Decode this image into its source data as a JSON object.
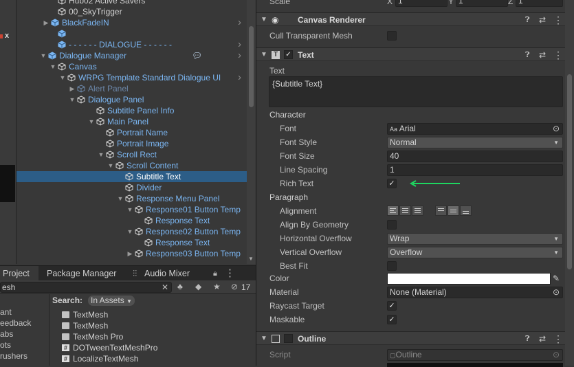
{
  "hierarchy": {
    "items": [
      {
        "label": "Hub02 Active Savers",
        "color": "white",
        "fold": ""
      },
      {
        "label": "00_SkyTrigger",
        "color": "white",
        "fold": ""
      },
      {
        "label": "BlackFadeIN",
        "color": "blue",
        "fold": "▶"
      },
      {
        "label": "",
        "color": "blue",
        "fold": ""
      },
      {
        "label": "- - - - - - DIALOGUE - - - - - -",
        "color": "blue",
        "fold": ""
      },
      {
        "label": "Dialogue Manager",
        "color": "blue",
        "fold": "▼"
      },
      {
        "label": "Canvas",
        "color": "blue",
        "fold": "▼"
      },
      {
        "label": "WRPG Template Standard Dialogue UI",
        "color": "blue",
        "fold": "▼"
      },
      {
        "label": "Alert Panel",
        "color": "dim",
        "fold": "▶"
      },
      {
        "label": "Dialogue Panel",
        "color": "blue",
        "fold": "▼"
      },
      {
        "label": "Subtitle Panel Info",
        "color": "blue",
        "fold": ""
      },
      {
        "label": "Main Panel",
        "color": "blue",
        "fold": "▼"
      },
      {
        "label": "Portrait Name",
        "color": "blue",
        "fold": ""
      },
      {
        "label": "Portrait Image",
        "color": "blue",
        "fold": ""
      },
      {
        "label": "Scroll Rect",
        "color": "blue",
        "fold": "▼"
      },
      {
        "label": "Scroll Content",
        "color": "blue",
        "fold": "▼"
      },
      {
        "label": "Subtitle Text",
        "color": "white",
        "fold": ""
      },
      {
        "label": "Divider",
        "color": "blue",
        "fold": ""
      },
      {
        "label": "Response Menu Panel",
        "color": "blue",
        "fold": "▼"
      },
      {
        "label": "Response01 Button Temp",
        "color": "blue",
        "fold": "▼"
      },
      {
        "label": "Response Text",
        "color": "blue",
        "fold": ""
      },
      {
        "label": "Response02 Button Temp",
        "color": "blue",
        "fold": "▼"
      },
      {
        "label": "Response Text",
        "color": "blue",
        "fold": ""
      },
      {
        "label": "Response03 Button Temp",
        "color": "blue",
        "fold": "▶"
      }
    ]
  },
  "scene_strip_label": "x",
  "tabs": {
    "project": "Project",
    "package_manager": "Package Manager",
    "audio_mixer": "Audio Mixer",
    "hidden_count": "17"
  },
  "project": {
    "search_value": "esh",
    "search_label": "Search:",
    "scope_label": "In Assets",
    "tree_items": [
      "ant",
      "eedback",
      "abs",
      "ots",
      "rushers"
    ],
    "results": [
      {
        "label": "TextMesh",
        "icon": "folder-icon"
      },
      {
        "label": "TextMesh",
        "icon": "folder-icon"
      },
      {
        "label": "TextMesh Pro",
        "icon": "folder-icon"
      },
      {
        "label": "DOTweenTextMeshPro",
        "icon": "script-icon"
      },
      {
        "label": "LocalizeTextMesh",
        "icon": "script-icon"
      }
    ]
  },
  "inspector": {
    "top_row": {
      "label": "Scale",
      "x": "X",
      "x_val": "1",
      "y": "Y",
      "y_val": "1",
      "z": "Z",
      "z_val": "1"
    },
    "canvas_renderer": {
      "title": "Canvas Renderer",
      "cull_label": "Cull Transparent Mesh"
    },
    "text": {
      "title": "Text",
      "text_label": "Text",
      "text_value": "{Subtitle Text}",
      "character_header": "Character",
      "font_label": "Font",
      "font_value": "Arial",
      "font_style_label": "Font Style",
      "font_style_value": "Normal",
      "font_size_label": "Font Size",
      "font_size_value": "40",
      "line_spacing_label": "Line Spacing",
      "line_spacing_value": "1",
      "rich_text_label": "Rich Text",
      "paragraph_header": "Paragraph",
      "alignment_label": "Alignment",
      "align_geometry_label": "Align By Geometry",
      "h_overflow_label": "Horizontal Overflow",
      "h_overflow_value": "Wrap",
      "v_overflow_label": "Vertical Overflow",
      "v_overflow_value": "Overflow",
      "best_fit_label": "Best Fit",
      "color_label": "Color",
      "material_label": "Material",
      "material_value": "None (Material)",
      "raycast_label": "Raycast Target",
      "maskable_label": "Maskable"
    },
    "outline": {
      "title": "Outline",
      "script_label": "Script",
      "script_value": "Outline"
    },
    "colors": {
      "arrow": "#1ed760",
      "selection": "#2c5d87",
      "link_blue": "#7bb6f2"
    }
  }
}
